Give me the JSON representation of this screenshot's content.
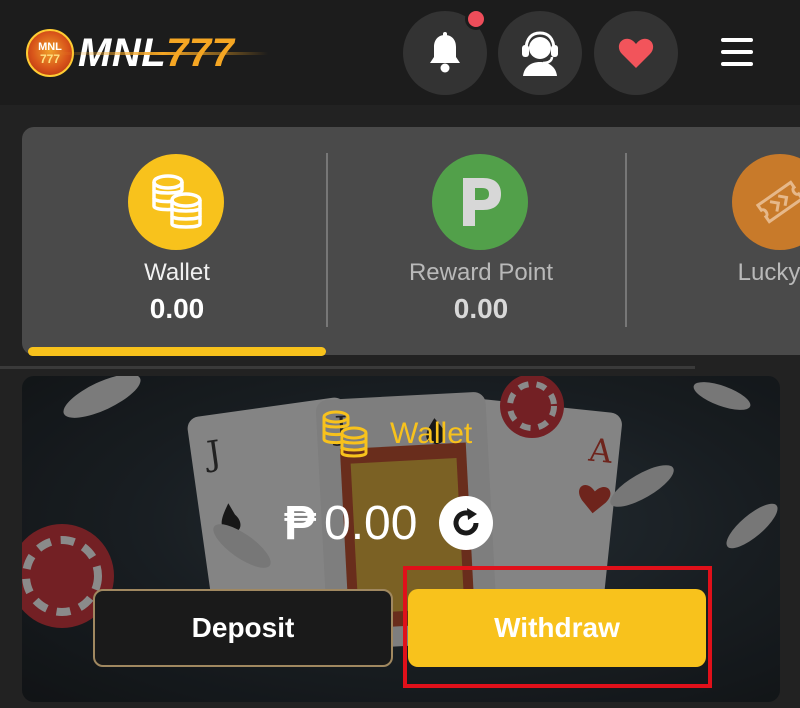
{
  "header": {
    "logo": {
      "badge_line1": "MNL",
      "badge_line2": "777",
      "text_mnl": "MNL",
      "text_777": "777"
    },
    "icons": [
      "bell-icon",
      "headset-support-icon",
      "heart-icon",
      "hamburger-menu-icon"
    ],
    "notification_dot_color": "#ee4d5a"
  },
  "tabs": [
    {
      "label": "Wallet",
      "value": "0.00",
      "icon": "coin-stack-icon",
      "icon_color": "#f8c21c",
      "active": true
    },
    {
      "label": "Reward Point",
      "value": "0.00",
      "icon": "p-letter-icon",
      "icon_color": "#52a04a",
      "active": false
    },
    {
      "label": "Lucky D",
      "value": "",
      "icon": "ticket-icon",
      "icon_color": "#c87a2a",
      "active": false
    }
  ],
  "wallet": {
    "title": "Wallet",
    "currency": "₱",
    "balance": "0.00",
    "deposit_label": "Deposit",
    "withdraw_label": "Withdraw"
  },
  "colors": {
    "accent": "#f8c21c",
    "highlight_box": "#e0101a"
  }
}
